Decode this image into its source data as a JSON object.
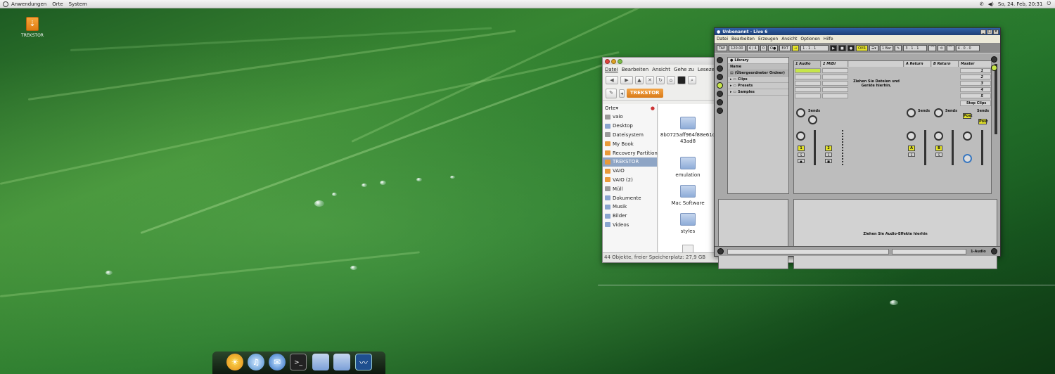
{
  "top_panel": {
    "menus": [
      "Anwendungen",
      "Orte",
      "System"
    ],
    "clock": "So, 24. Feb, 20:31"
  },
  "desktop": {
    "icons": [
      {
        "label": "TREKSTOR",
        "icon": "usb-drive-icon"
      }
    ]
  },
  "file_manager": {
    "menu": [
      "Datei",
      "Bearbeiten",
      "Ansicht",
      "Gehe zu",
      "Lesezeich"
    ],
    "breadcrumb": "TREKSTOR",
    "sidebar_title": "Orte",
    "places": [
      {
        "label": "vaio",
        "icon": "home-icon"
      },
      {
        "label": "Desktop",
        "icon": "desktop-icon"
      },
      {
        "label": "Dateisystem",
        "icon": "harddisk-icon"
      },
      {
        "label": "My Book",
        "icon": "drive-icon"
      },
      {
        "label": "Recovery Partition",
        "icon": "drive-icon"
      },
      {
        "label": "TREKSTOR",
        "icon": "usb-drive-icon",
        "selected": true
      },
      {
        "label": "VAIO",
        "icon": "drive-icon"
      },
      {
        "label": "VAIO (2)",
        "icon": "drive-icon"
      },
      {
        "label": "Müll",
        "icon": "trash-icon"
      },
      {
        "label": "Dokumente",
        "icon": "folder-icon"
      },
      {
        "label": "Musik",
        "icon": "folder-icon"
      },
      {
        "label": "Bilder",
        "icon": "folder-icon"
      },
      {
        "label": "Videos",
        "icon": "folder-icon"
      }
    ],
    "files": [
      "8b0725aff964f88e61d43ad8",
      "emulation",
      "Mac Software",
      "styles"
    ],
    "status": "44 Objekte, freier Speicherplatz: 27,9 GB"
  },
  "live": {
    "title": "Unbenannt - Live 6",
    "menu": [
      "Datei",
      "Bearbeiten",
      "Erzeugen",
      "Ansicht",
      "Optionen",
      "Hilfe"
    ],
    "transport": {
      "tap": "TAP",
      "tempo": "120.00",
      "signature": "4 / 4",
      "loop": "0",
      "ext": "EXT",
      "position": "1 . 1 . 1",
      "ovr": "OVR",
      "quantize": "1 Bar",
      "loop_start": "3 . 1 . 1",
      "loop_len": "4 . 0 . 0"
    },
    "browser": {
      "title": "Library",
      "column": "Name",
      "items": [
        "(Übergeordneter Ordner)",
        "Clips",
        "Presets",
        "Samples"
      ]
    },
    "tracks": [
      {
        "name": "1 Audio",
        "number": "1"
      },
      {
        "name": "2 MIDI",
        "number": "2"
      },
      {
        "name": "A Return",
        "number": "A"
      },
      {
        "name": "B Return",
        "number": "B"
      },
      {
        "name": "Master",
        "number": ""
      }
    ],
    "drop_hint": "Ziehen Sie Dateien und Geräte hierhin.",
    "sends_label": "Sends",
    "stop_clips": "Stop Clips",
    "post_label": "Post",
    "scenes": [
      "1",
      "2",
      "3",
      "4",
      "5"
    ],
    "effects_hint": "Ziehen Sie Audio-Effekte hierhin",
    "status_track": "1-Audio"
  },
  "dock": {
    "items": [
      "weather-icon",
      "music-icon",
      "chat-icon",
      "terminal-icon",
      "folder-icon",
      "folder-icon",
      "system-monitor-icon"
    ]
  }
}
